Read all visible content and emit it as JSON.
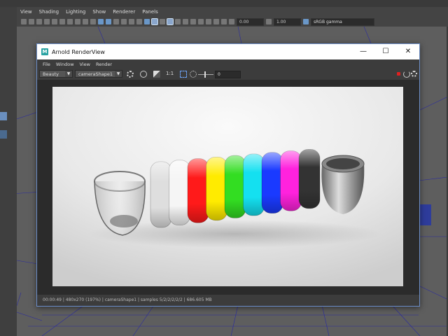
{
  "maya": {
    "menubar": [
      "View",
      "Shading",
      "Lighting",
      "Show",
      "Renderer",
      "Panels"
    ],
    "toolbar": {
      "field1": "0.00",
      "field2": "1.00",
      "colorspace": "sRGB gamma"
    }
  },
  "renderview": {
    "title": "Arnold RenderView",
    "logo": "M",
    "window_controls": [
      "—",
      "☐",
      "✕"
    ],
    "menu": [
      "File",
      "Window",
      "View",
      "Render"
    ],
    "toolbar": {
      "aov": "Beauty",
      "camera": "cameraShape1",
      "ratio": "1:1",
      "exposure": "0"
    },
    "status": "00:00:49 | 480x270 (197%) | cameraShape1 | samples 5/2/2/2/2/2 | 686.605 MB"
  },
  "colors": {
    "accent": "#6d8fc9",
    "stop_button": "#e02020"
  },
  "render": {
    "rings": [
      "#dedede",
      "#f5f5f5",
      "#ff1a1a",
      "#ffeb00",
      "#33dd22",
      "#14e0f0",
      "#1a3aff",
      "#ff22dd",
      "#333333"
    ]
  }
}
